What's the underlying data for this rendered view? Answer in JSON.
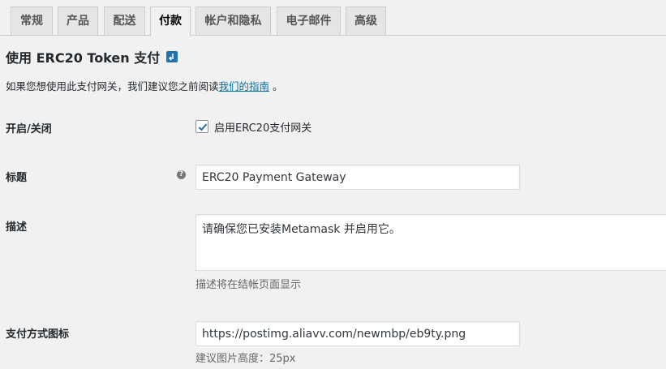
{
  "tabs": [
    {
      "label": "常规",
      "active": false
    },
    {
      "label": "产品",
      "active": false
    },
    {
      "label": "配送",
      "active": false
    },
    {
      "label": "付款",
      "active": true
    },
    {
      "label": "帐户和隐私",
      "active": false
    },
    {
      "label": "电子邮件",
      "active": false
    },
    {
      "label": "高级",
      "active": false
    }
  ],
  "section": {
    "title": "使用 ERC20 Token 支付",
    "back_icon": "return-arrow-icon"
  },
  "intro": {
    "text_before": "如果您想使用此支付网关，我们建议您之前阅读",
    "link_text": "我们的指南",
    "text_after": " 。"
  },
  "fields": {
    "enable": {
      "label": "开启/关闭",
      "checkbox_label": "启用ERC20支付网关",
      "checked": true
    },
    "title": {
      "label": "标题",
      "value": "ERC20 Payment Gateway",
      "help_icon": "question-mark-icon"
    },
    "description": {
      "label": "描述",
      "value": "请确保您已安装Metamask 并启用它。",
      "hint": "描述将在结帐页面显示"
    },
    "icon": {
      "label": "支付方式图标",
      "value": "https://postimg.aliavv.com/newmbp/eb9ty.png",
      "hint": "建议图片高度：25px"
    }
  },
  "colors": {
    "link": "#0073aa",
    "accent": "#2271b1",
    "background": "#f1f1f1"
  }
}
